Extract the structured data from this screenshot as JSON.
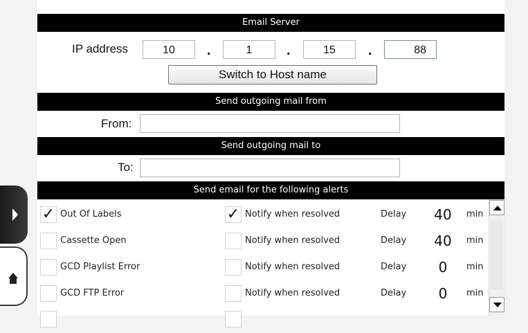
{
  "email_server": {
    "header": "Email Server",
    "ip_label": "IP address",
    "ip_octets": [
      "10",
      "1",
      "15",
      "88"
    ],
    "ip_separator": ".",
    "switch_button": "Switch to Host name"
  },
  "send_from": {
    "header": "Send outgoing mail from",
    "label": "From:",
    "value": ""
  },
  "send_to": {
    "header": "Send outgoing mail to",
    "label": "To:",
    "value": ""
  },
  "alerts": {
    "header": "Send email for the following alerts",
    "checkmark": "✓",
    "rows": [
      {
        "name": "Out Of Labels",
        "checked": true,
        "notify_label": "Notify when resolved",
        "notify_checked": true,
        "delay_label": "Delay",
        "delay": "40",
        "unit": "min"
      },
      {
        "name": "Cassette Open",
        "checked": false,
        "notify_label": "Notify when resolved",
        "notify_checked": false,
        "delay_label": "Delay",
        "delay": "40",
        "unit": "min"
      },
      {
        "name": "GCD Playlist Error",
        "checked": false,
        "notify_label": "Notify when resolved",
        "notify_checked": false,
        "delay_label": "Delay",
        "delay": "0",
        "unit": "min"
      },
      {
        "name": "GCD FTP Error",
        "checked": false,
        "notify_label": "Notify when resolved",
        "notify_checked": false,
        "delay_label": "Delay",
        "delay": "0",
        "unit": "min"
      }
    ]
  },
  "colors": {
    "header_bar": "#000000",
    "header_text": "#ffffff",
    "side_tab": "#2a2a2a"
  },
  "icons": {
    "expand": "chevron-right-icon",
    "home": "home-icon",
    "scroll_up": "triangle-up-icon",
    "scroll_down": "triangle-down-icon"
  }
}
